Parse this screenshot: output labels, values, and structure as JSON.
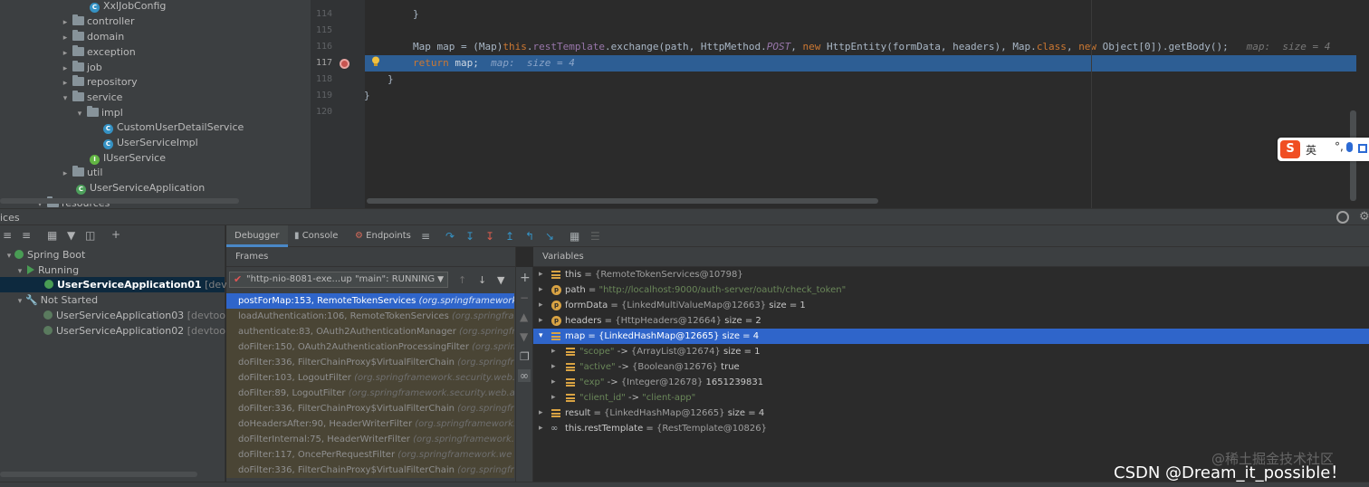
{
  "project_tree": {
    "items": [
      {
        "label": "XxlJobConfig",
        "kind": "class"
      },
      {
        "label": "controller",
        "kind": "folder"
      },
      {
        "label": "domain",
        "kind": "folder"
      },
      {
        "label": "exception",
        "kind": "folder"
      },
      {
        "label": "job",
        "kind": "folder"
      },
      {
        "label": "repository",
        "kind": "folder"
      },
      {
        "label": "service",
        "kind": "folder"
      },
      {
        "label": "impl",
        "kind": "folder"
      },
      {
        "label": "CustomUserDetailService",
        "kind": "class"
      },
      {
        "label": "UserServiceImpl",
        "kind": "class"
      },
      {
        "label": "IUserService",
        "kind": "interface"
      },
      {
        "label": "util",
        "kind": "folder"
      },
      {
        "label": "UserServiceApplication",
        "kind": "boot-class"
      },
      {
        "label": "resources",
        "kind": "folder"
      }
    ]
  },
  "editor": {
    "line_numbers": [
      "114",
      "115",
      "116",
      "117",
      "118",
      "119",
      "120"
    ],
    "current_line": "117",
    "line114": "}",
    "line116": {
      "a": "Map map = (Map)",
      "this_kw": "this",
      "dot": ".",
      "field": "restTemplate",
      "b": ".exchange(path, HttpMethod.",
      "post": "POST",
      "c": ", ",
      "new1": "new",
      "d": " HttpEntity(formData, headers), Map.",
      "class_kw": "class",
      "e": ", ",
      "new2": "new",
      "f": " Object[0]).getBody();",
      "inline": "map:  size = 4"
    },
    "line117": {
      "kw": "return",
      "rest": " map;",
      "inline": "map:  size = 4"
    },
    "line118": "}",
    "line119": "}"
  },
  "ime": {
    "logo": "S",
    "lang": "英",
    "punc": "°,"
  },
  "services": {
    "header_title": "ices",
    "tree": [
      {
        "label": "Spring Boot",
        "note": ""
      },
      {
        "label": "Running",
        "note": ""
      },
      {
        "label": "UserServiceApplication01",
        "note": "[devtools]"
      },
      {
        "label": "Not Started",
        "note": ""
      },
      {
        "label": "UserServiceApplication03",
        "note": "[devtools]"
      },
      {
        "label": "UserServiceApplication02",
        "note": "[devtools]"
      }
    ]
  },
  "debugger": {
    "tabs": [
      "Debugger",
      "Console",
      "Endpoints"
    ],
    "frames_title": "Frames",
    "variables_title": "Variables",
    "thread": "\"http-nio-8081-exe...up \"main\": RUNNING",
    "frames": [
      {
        "method": "postForMap:153, RemoteTokenServices ",
        "pkg": "(org.springframework"
      },
      {
        "method": "loadAuthentication:106, RemoteTokenServices ",
        "pkg": "(org.springfram"
      },
      {
        "method": "authenticate:83, OAuth2AuthenticationManager ",
        "pkg": "(org.springfran"
      },
      {
        "method": "doFilter:150, OAuth2AuthenticationProcessingFilter ",
        "pkg": "(org.springf"
      },
      {
        "method": "doFilter:336, FilterChainProxy$VirtualFilterChain ",
        "pkg": "(org.springfram"
      },
      {
        "method": "doFilter:103, LogoutFilter ",
        "pkg": "(org.springframework.security.web.a"
      },
      {
        "method": "doFilter:89, LogoutFilter ",
        "pkg": "(org.springframework.security.web.au"
      },
      {
        "method": "doFilter:336, FilterChainProxy$VirtualFilterChain ",
        "pkg": "(org.springfram"
      },
      {
        "method": "doHeadersAfter:90, HeaderWriterFilter ",
        "pkg": "(org.springframework.s"
      },
      {
        "method": "doFilterInternal:75, HeaderWriterFilter ",
        "pkg": "(org.springframework.s"
      },
      {
        "method": "doFilter:117, OncePerRequestFilter ",
        "pkg": "(org.springframework.we"
      },
      {
        "method": "doFilter:336, FilterChainProxy$VirtualFilterChain ",
        "pkg": "(org.springfram"
      }
    ],
    "variables": [
      {
        "name": "this",
        "eq": " = ",
        "type": "{RemoteTokenServices@10798}",
        "value": ""
      },
      {
        "name": "path",
        "eq": " = ",
        "type": "",
        "value": "\"http://localhost:9000/auth-server/oauth/check_token\""
      },
      {
        "name": "formData",
        "eq": " = ",
        "type": "{LinkedMultiValueMap@12663}",
        "value": "  size = 1"
      },
      {
        "name": "headers",
        "eq": " = ",
        "type": "{HttpHeaders@12664}",
        "value": "  size = 2"
      },
      {
        "name": "map",
        "eq": " = ",
        "type": "{LinkedHashMap@12665}",
        "value": "  size = 4"
      },
      {
        "name": "\"scope\"",
        "eq": " -> ",
        "type": "{ArrayList@12674}",
        "value": "  size = 1"
      },
      {
        "name": "\"active\"",
        "eq": " -> ",
        "type": "{Boolean@12676}",
        "value": " true"
      },
      {
        "name": "\"exp\"",
        "eq": " -> ",
        "type": "{Integer@12678}",
        "value": " 1651239831"
      },
      {
        "name": "\"client_id\"",
        "eq": " -> ",
        "type": "",
        "value": "\"client-app\""
      },
      {
        "name": "result",
        "eq": " = ",
        "type": "{LinkedHashMap@12665}",
        "value": "  size = 4"
      },
      {
        "name": "this.restTemplate",
        "eq": " = ",
        "type": "{RestTemplate@10826}",
        "value": ""
      }
    ]
  },
  "watermarks": {
    "juejin": "@稀土掘金技术社区",
    "csdn": "CSDN @Dream_it_possible！"
  }
}
